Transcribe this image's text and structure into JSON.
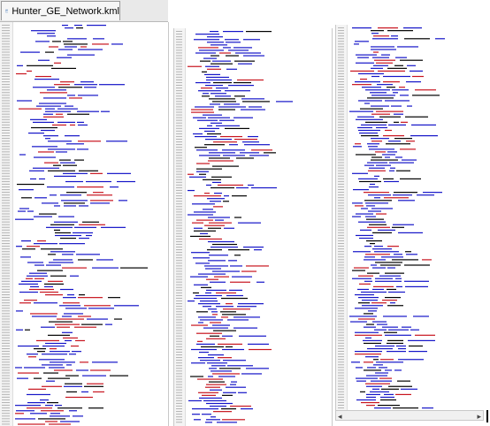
{
  "file_tab": {
    "label": "Hunter_GE_Network.kml",
    "icon": "kml-file-icon"
  },
  "editor": {
    "panes": [
      {
        "name": "code-pane-1"
      },
      {
        "name": "code-pane-2"
      },
      {
        "name": "code-pane-3"
      }
    ]
  },
  "colors": {
    "tag_blue": "#1414c8",
    "attr_red": "#c8141e",
    "gutter_gray": "#9a9a9a",
    "plain_black": "#000000"
  },
  "scrollbar": {
    "left_arrow": "◂",
    "right_arrow": "▸"
  }
}
